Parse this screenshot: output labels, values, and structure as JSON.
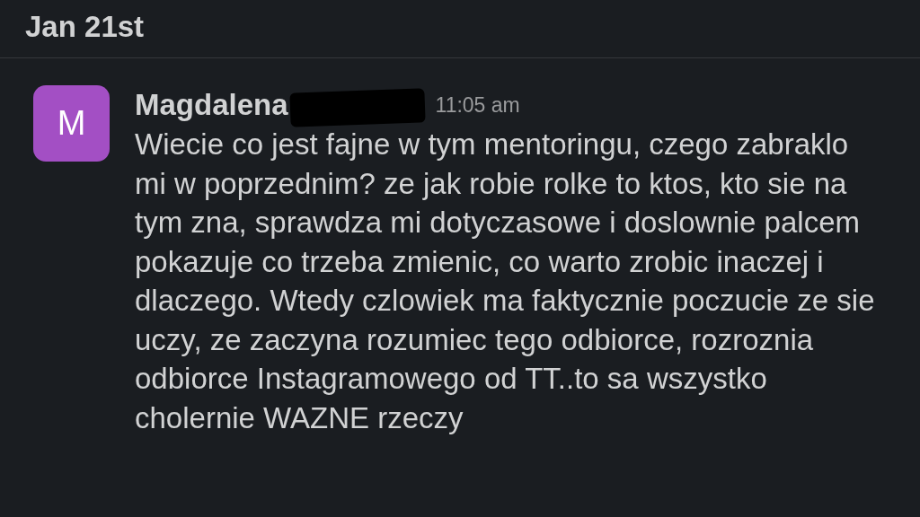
{
  "date_header": "Jan 21st",
  "message": {
    "avatar_letter": "M",
    "author": "Magdalena",
    "name_redacted": true,
    "time": "11:05 am",
    "text": "Wiecie co jest fajne w tym mentoringu, czego zabraklo mi w poprzednim? ze jak robie rolke to ktos, kto sie na tym zna, sprawdza mi dotyczasowe i doslownie palcem pokazuje co trzeba zmienic, co warto zrobic inaczej i dlaczego. Wtedy czlowiek ma faktycznie poczucie ze sie uczy, ze zaczyna rozumiec tego odbiorce, rozroznia odbiorce Instagramowego od TT..to sa wszystko cholernie WAZNE rzeczy"
  }
}
